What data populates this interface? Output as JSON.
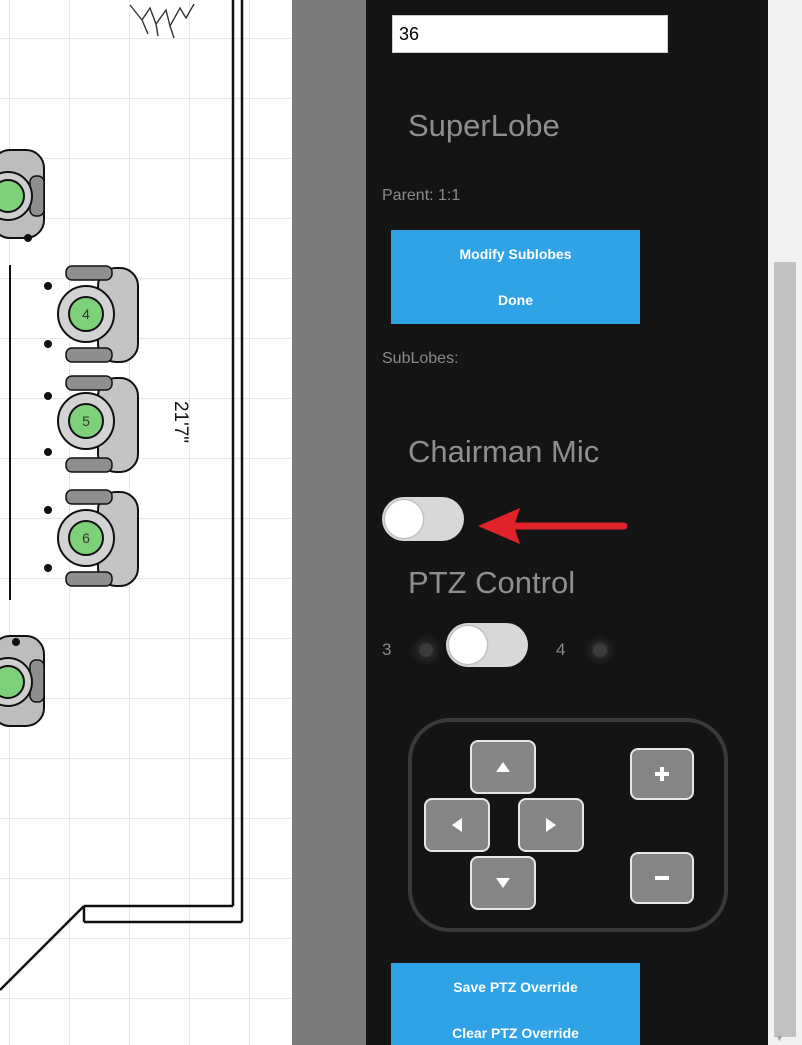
{
  "panel": {
    "number_value": "36",
    "superlobe_heading": "SuperLobe",
    "parent_text": "Parent: 1:1",
    "modify_sublobes_label": "Modify Sublobes",
    "done_label": "Done",
    "sublobes_label": "SubLobes:",
    "chairman_heading": "Chairman Mic",
    "chairman_toggle_on": false,
    "ptz_heading": "PTZ Control",
    "ptz_left_number": "3",
    "ptz_right_number": "4",
    "save_ptz_label": "Save PTZ Override",
    "clear_ptz_label": "Clear PTZ Override"
  },
  "floorplan": {
    "dimension_label": "21'7\"",
    "seats": [
      {
        "number": "4"
      },
      {
        "number": "5"
      },
      {
        "number": "6"
      }
    ]
  },
  "icons": {
    "arrow_annotation": "red-arrow-icon",
    "up": "triangle-up-icon",
    "down": "triangle-down-icon",
    "left": "triangle-left-icon",
    "right": "triangle-right-icon",
    "zoom_in": "plus-icon",
    "zoom_out": "minus-icon"
  },
  "colors": {
    "panel_bg": "#141414",
    "accent_blue": "#2fa3e6",
    "seat_green": "#7ed07a",
    "annotation_red": "#e0232a"
  }
}
